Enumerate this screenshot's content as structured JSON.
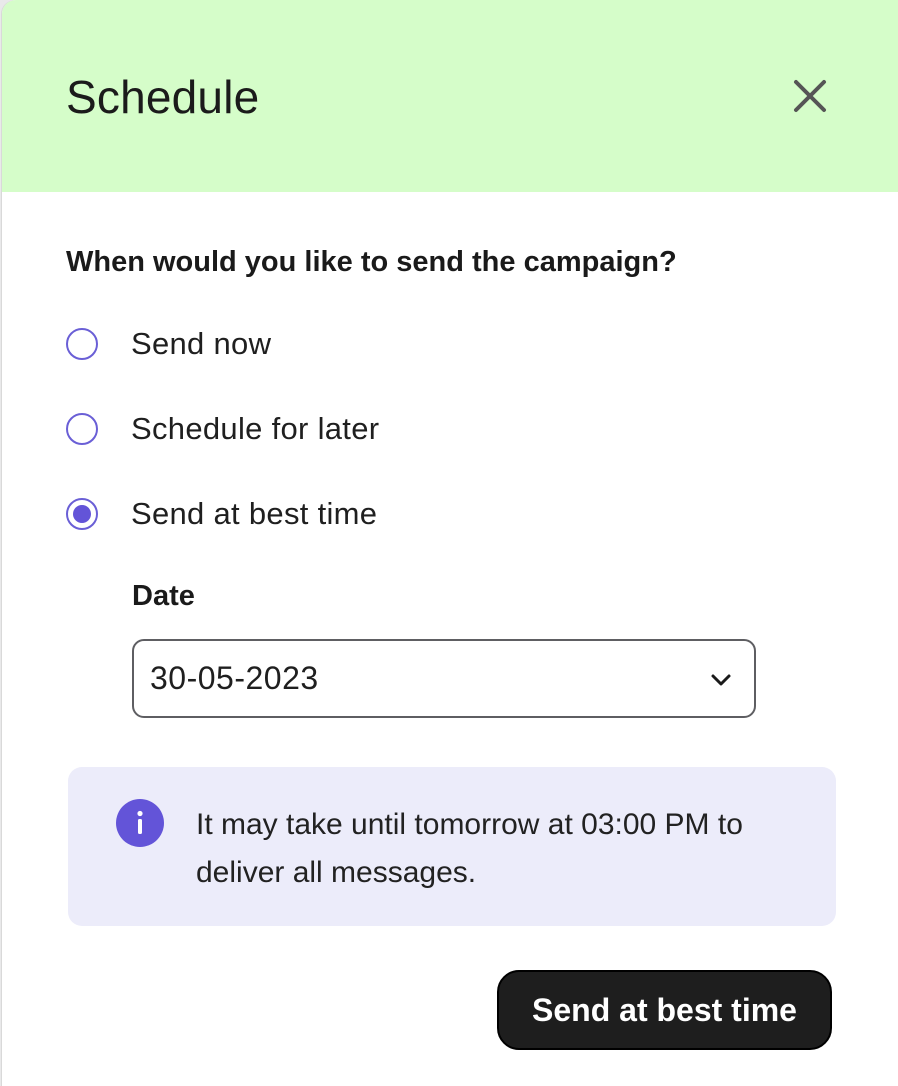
{
  "dialog": {
    "title": "Schedule",
    "close_icon": "close-icon"
  },
  "form": {
    "question": "When would you like to send the campaign?",
    "options": [
      {
        "label": "Send now",
        "selected": false
      },
      {
        "label": "Schedule for later",
        "selected": false
      },
      {
        "label": "Send at best time",
        "selected": true
      }
    ],
    "date_label": "Date",
    "date_value": "30-05-2023",
    "dropdown_icon": "chevron-down-icon"
  },
  "info": {
    "icon": "info-icon",
    "message": "It may take until tomorrow at 03:00 PM to deliver all messages."
  },
  "actions": {
    "primary_label": "Send at best time"
  },
  "colors": {
    "header_bg": "#d5fdc9",
    "accent": "#6354d8",
    "info_bg": "#ececfa",
    "primary_btn": "#1e1e1e"
  }
}
